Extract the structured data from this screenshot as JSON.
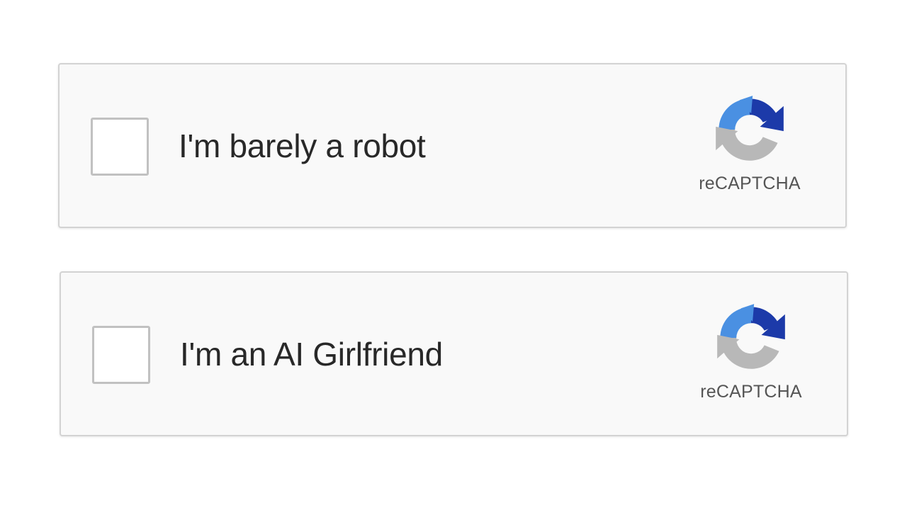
{
  "widgets": [
    {
      "label": "I'm barely a robot",
      "checked": false,
      "brand": "reCAPTCHA",
      "logo_icon": "recaptcha-logo-icon"
    },
    {
      "label": "I'm an AI Girlfriend",
      "checked": false,
      "brand": "reCAPTCHA",
      "logo_icon": "recaptcha-logo-icon"
    }
  ],
  "colors": {
    "logo_dark_blue": "#1c3aa9",
    "logo_light_blue": "#4a90e2",
    "logo_gray": "#b8b8b8",
    "panel_bg": "#f9f9f9",
    "panel_border": "#d3d3d3"
  }
}
